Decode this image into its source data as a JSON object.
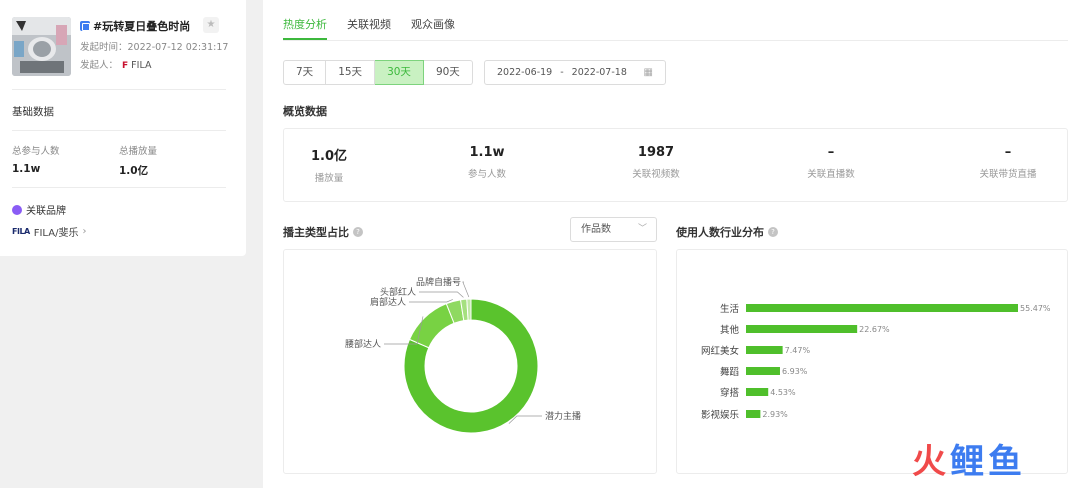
{
  "topic": {
    "title": "#玩转夏日叠色时尚",
    "publish_label": "发起时间：",
    "publish_time": "2022-07-12 02:31:17",
    "initiator_label": "发起人：",
    "initiator_name": "FILA"
  },
  "basic": {
    "section_title": "基础数据",
    "participants_label": "总参与人数",
    "participants_value": "1.1w",
    "plays_label": "总播放量",
    "plays_value": "1.0亿",
    "brand_section": "关联品牌",
    "brand_name": "FILA/斐乐"
  },
  "tabs": [
    {
      "label": "热度分析",
      "active": true
    },
    {
      "label": "关联视频",
      "active": false
    },
    {
      "label": "观众画像",
      "active": false
    }
  ],
  "ranges": [
    {
      "label": "7天",
      "active": false
    },
    {
      "label": "15天",
      "active": false
    },
    {
      "label": "30天",
      "active": true
    },
    {
      "label": "90天",
      "active": false
    }
  ],
  "date_range": {
    "start": "2022-06-19",
    "sep": "-",
    "end": "2022-07-18"
  },
  "overview": {
    "title": "概览数据",
    "items": [
      {
        "value": "1.0亿",
        "label": "播放量"
      },
      {
        "value": "1.1w",
        "label": "参与人数"
      },
      {
        "value": "1987",
        "label": "关联视频数"
      },
      {
        "value": "–",
        "label": "关联直播数"
      },
      {
        "value": "–",
        "label": "关联带货直播"
      }
    ]
  },
  "accent_color": "#3cb83c",
  "chart_data": [
    {
      "type": "pie",
      "title": "播主类型占比",
      "selector": "作品数",
      "categories": [
        "潜力主播",
        "腰部达人",
        "肩部达人",
        "头部红人",
        "品牌自播号"
      ],
      "values": [
        81.5,
        12.5,
        3.5,
        1.5,
        1.0
      ],
      "colors": [
        "#5ac32d",
        "#78d243",
        "#8fd961",
        "#a5e07f",
        "#c2e9a8"
      ]
    },
    {
      "type": "bar",
      "title": "使用人数行业分布",
      "categories": [
        "生活",
        "其他",
        "网红美女",
        "舞蹈",
        "穿搭",
        "影视娱乐"
      ],
      "values": [
        55.47,
        22.67,
        7.47,
        6.93,
        4.53,
        2.93
      ],
      "value_labels": [
        "55.47%",
        "22.67%",
        "7.47%",
        "6.93%",
        "4.53%",
        "2.93%"
      ],
      "color": "#4fbf2b"
    }
  ],
  "watermark": {
    "c1": "火",
    "c2": "鲤",
    "c3": "鱼"
  }
}
